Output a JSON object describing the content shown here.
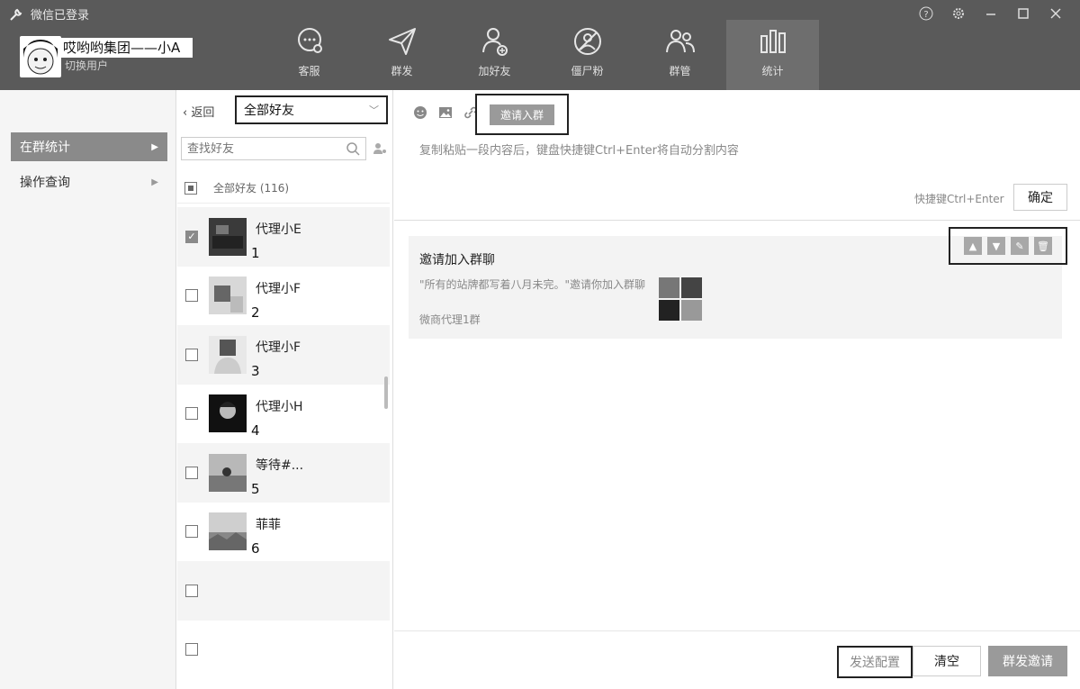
{
  "window": {
    "title": "微信已登录"
  },
  "user": {
    "name": "哎哟哟集团——小A",
    "switch_label": "切换用户"
  },
  "nav": {
    "items": [
      {
        "label": "客服",
        "icon": "chat-icon"
      },
      {
        "label": "群发",
        "icon": "send-icon"
      },
      {
        "label": "加好友",
        "icon": "add-friend-icon"
      },
      {
        "label": "僵尸粉",
        "icon": "zombie-icon"
      },
      {
        "label": "群管",
        "icon": "group-manage-icon"
      },
      {
        "label": "统计",
        "icon": "stats-icon"
      }
    ],
    "active_index": 5
  },
  "sidebar": {
    "items": [
      {
        "label": "在群统计"
      },
      {
        "label": "操作查询"
      }
    ]
  },
  "friends": {
    "back_label": "返回",
    "filter_value": "全部好友",
    "search_placeholder": "查找好友",
    "all_label": "全部好友",
    "all_count": "(116)",
    "rows": [
      {
        "name": "代理小E",
        "index": "1",
        "checked": true
      },
      {
        "name": "代理小F",
        "index": "2",
        "checked": false
      },
      {
        "name": "代理小F",
        "index": "3",
        "checked": false
      },
      {
        "name": "代理小H",
        "index": "4",
        "checked": false
      },
      {
        "name": "等待#...",
        "index": "5",
        "checked": false
      },
      {
        "name": "菲菲",
        "index": "6",
        "checked": false
      },
      {
        "name": "",
        "index": "",
        "checked": false
      },
      {
        "name": "",
        "index": "",
        "checked": false
      }
    ]
  },
  "editor": {
    "invite_label": "邀请入群",
    "paste_hint": "复制粘贴一段内容后，键盘快捷键Ctrl+Enter将自动分割内容",
    "shortcut_label": "快捷键Ctrl+Enter",
    "ok_label": "确定"
  },
  "card": {
    "title": "邀请加入群聊",
    "description": "\"所有的站牌都写着八月未完。\"邀请你加入群聊",
    "group": "微商代理1群"
  },
  "footer": {
    "send_config_label": "发送配置",
    "clear_label": "清空",
    "mass_invite_label": "群发邀请"
  }
}
